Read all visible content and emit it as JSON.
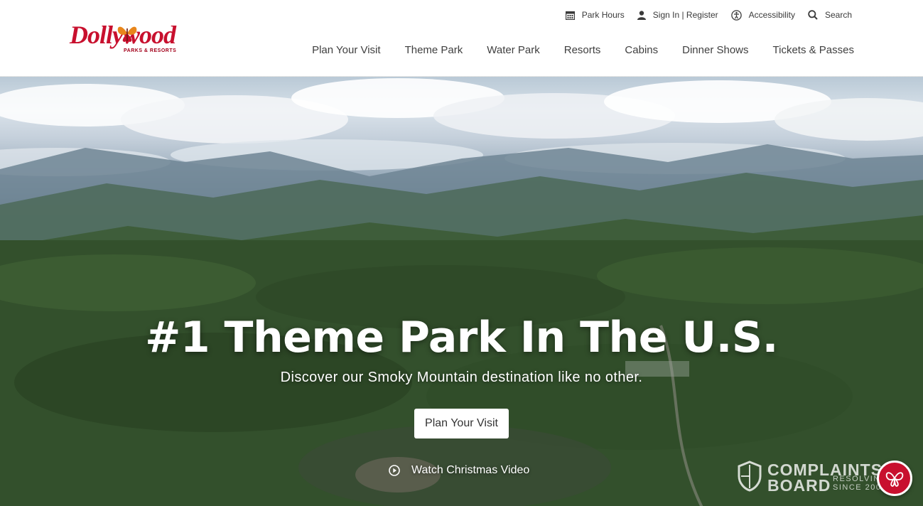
{
  "brand": {
    "logo_text": "Dollywood",
    "logo_sub": "PARKS & RESORTS",
    "primary_color": "#c8102e"
  },
  "utility_nav": [
    {
      "label": "Park Hours",
      "icon": "calendar-icon"
    },
    {
      "label": "Sign In | Register",
      "icon": "user-icon"
    },
    {
      "label": "Accessibility",
      "icon": "accessibility-icon"
    },
    {
      "label": "Search",
      "icon": "search-icon"
    }
  ],
  "main_nav": [
    {
      "label": "Plan Your Visit"
    },
    {
      "label": "Theme Park"
    },
    {
      "label": "Water Park"
    },
    {
      "label": "Resorts"
    },
    {
      "label": "Cabins"
    },
    {
      "label": "Dinner Shows"
    },
    {
      "label": "Tickets & Passes"
    }
  ],
  "hero": {
    "title": "#1 Theme Park In The U.S.",
    "subtitle": "Discover our Smoky Mountain destination like no other.",
    "cta_label": "Plan Your Visit",
    "video_label": "Watch Christmas Video"
  },
  "watermark": {
    "line1": "COMPLAINTS",
    "line2": "BOARD",
    "tag1": "RESOLVING",
    "tag2": "SINCE 2004"
  },
  "chat": {
    "icon": "butterfly-icon"
  }
}
